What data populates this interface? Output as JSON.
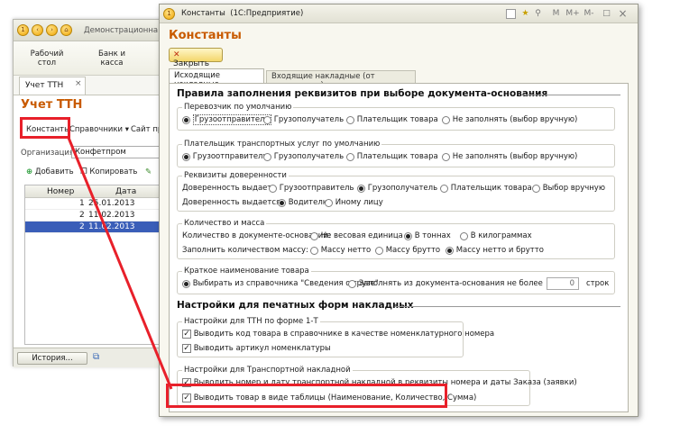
{
  "background_window": {
    "title": "Демонстрационна",
    "nav": [
      "Рабочий стол",
      "Банк и касса"
    ],
    "tab": "Учет ТТН",
    "page_title": "Учет ТТН",
    "toolbar": {
      "constants": "Константы",
      "handbooks": "Справочники",
      "site": "Сайт пр"
    },
    "org_label": "Организация:",
    "org_value": "Конфетпром",
    "add_label": "Добавить",
    "copy_label": "Копировать",
    "grid": {
      "headers": [
        "Номер",
        "Дата"
      ],
      "rows": [
        [
          "1",
          "25.01.2013"
        ],
        [
          "2",
          "11.02.2013"
        ],
        [
          "2",
          "11.02.2013"
        ]
      ]
    },
    "history_label": "История..."
  },
  "dialog": {
    "title": "Константы",
    "app": "(1С:Предприятие)",
    "window_buttons": [
      "M",
      "M+",
      "M-",
      "□",
      "×"
    ],
    "heading": "Константы",
    "close_label": "Закрыть",
    "tabs": [
      "Исходящие накладные",
      "Входящие накладные (от поставщика)"
    ],
    "section1": "Правила заполнения реквизитов при выборе документа-основания",
    "carrier": {
      "title": "Перевозчик по умолчанию",
      "options": [
        "Грузоотправитель",
        "Грузополучатель",
        "Плательщик товара",
        "Не заполнять (выбор вручную)"
      ],
      "selected": 0
    },
    "payer": {
      "title": "Плательщик транспортных услуг по умолчанию",
      "options": [
        "Грузоотправитель",
        "Грузополучатель",
        "Плательщик товара",
        "Не заполнять (выбор вручную)"
      ],
      "selected": 0
    },
    "proxy": {
      "title": "Реквизиты доверенности",
      "row1_label": "Доверенность выдает:",
      "row1_options": [
        "Грузоотправитель",
        "Грузополучатель",
        "Плательщик товара",
        "Выбор вручную"
      ],
      "row1_selected": 1,
      "row2_label": "Доверенность выдается:",
      "row2_options": [
        "Водителю",
        "Иному лицу"
      ],
      "row2_selected": 0
    },
    "qty": {
      "title": "Количество и масса",
      "row1_label": "Количество в документе-основании:",
      "row1_options": [
        "Не весовая единица",
        "В тоннах",
        "В килограммах"
      ],
      "row1_selected": 1,
      "row2_label": "Заполнить количеством массу:",
      "row2_options": [
        "Массу нетто",
        "Массу брутто",
        "Массу нетто и брутто"
      ],
      "row2_selected": 2
    },
    "shortname": {
      "title": "Краткое наименование товара",
      "options": [
        "Выбирать из справочника \"Сведения о грузе\"",
        "Заполнять из документа-основания не более"
      ],
      "selected": 0,
      "value": "0",
      "unit": "строк"
    },
    "section2": "Настройки для печатных форм накладных",
    "ttn1t": {
      "title": "Настройки для ТТН по форме 1-Т",
      "items": [
        "Выводить код товара в справочнике в качестве номенклатурного номера",
        "Выводить артикул номенклатуры"
      ]
    },
    "transport": {
      "title": "Настройки для Транспортной накладной",
      "items": [
        "Выводить номер и дату транспортной накладной в реквизиты номера и даты Заказа (заявки)",
        "Выводить товар в виде таблицы (Наименование, Количество, Сумма)"
      ]
    }
  },
  "colors": {
    "accent": "#c85a00",
    "highlight": "#e8202a",
    "selection": "#3a5eb8"
  }
}
